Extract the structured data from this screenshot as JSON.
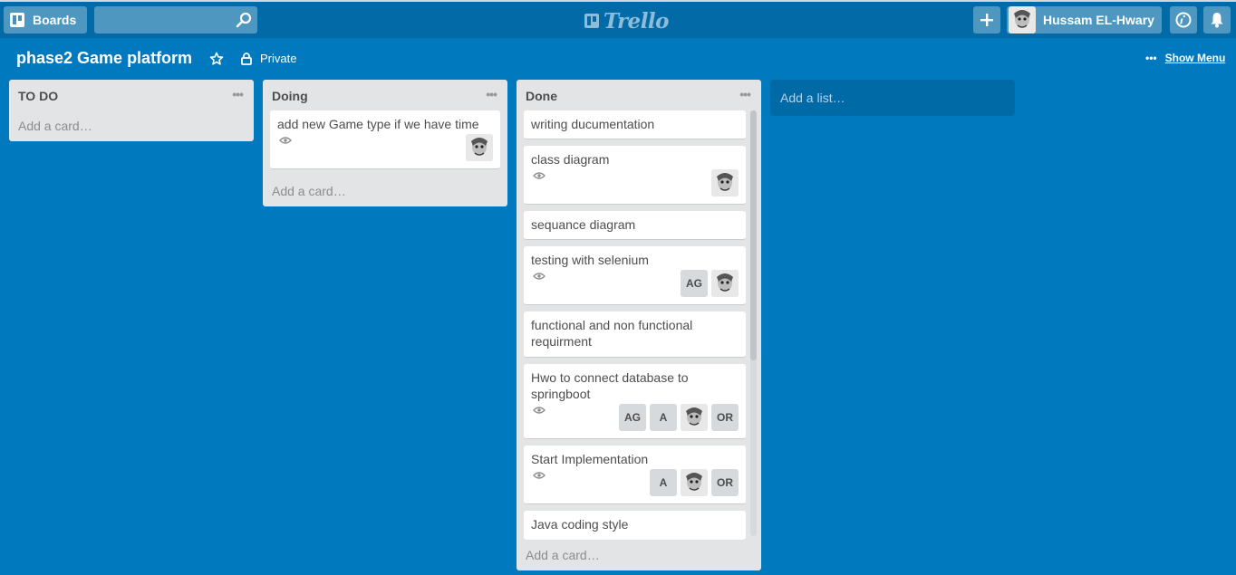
{
  "header": {
    "boards_label": "Boards",
    "search_placeholder": "",
    "logo_text": "Trello",
    "member_name": "Hussam EL-Hwary"
  },
  "board": {
    "title": "phase2 Game platform",
    "visibility": "Private",
    "show_menu": "Show Menu"
  },
  "lists": [
    {
      "title": "TO DO",
      "add_card": "Add a card…",
      "cards": []
    },
    {
      "title": "Doing",
      "add_card": "Add a card…",
      "cards": [
        {
          "title": "add new Game type if we have time",
          "watched": true,
          "members": [
            "avatar"
          ]
        }
      ]
    },
    {
      "title": "Done",
      "add_card": "Add a card…",
      "cards": [
        {
          "title": "writing ducumentation"
        },
        {
          "title": "class diagram",
          "watched": true,
          "members": [
            "avatar"
          ]
        },
        {
          "title": "sequance diagram"
        },
        {
          "title": "testing with selenium",
          "watched": true,
          "members": [
            "AG",
            "avatar"
          ]
        },
        {
          "title": "functional and non functional requirment"
        },
        {
          "title": "Hwo to connect database to springboot",
          "watched": true,
          "members": [
            "AG",
            "A",
            "avatar",
            "OR"
          ]
        },
        {
          "title": "Start Implementation",
          "watched": true,
          "members": [
            "A",
            "avatar",
            "OR"
          ]
        },
        {
          "title": "Java coding style"
        }
      ]
    }
  ],
  "add_list": "Add a list…",
  "colors": {
    "board_bg": "#0079bf",
    "header_bg": "#026aa7",
    "list_bg": "#e2e4e6"
  }
}
